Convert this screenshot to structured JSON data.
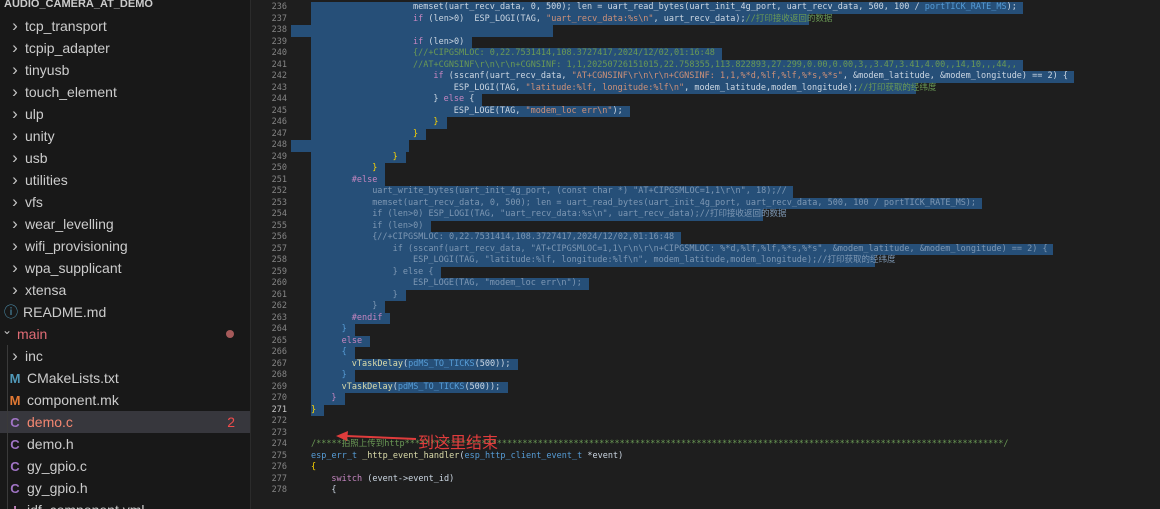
{
  "explorer": {
    "items": [
      {
        "label": "AUDIO_CAMERA_AT_DEMO",
        "kind": "header"
      },
      {
        "label": "tcp_transport",
        "kind": "folder"
      },
      {
        "label": "tcpip_adapter",
        "kind": "folder"
      },
      {
        "label": "tinyusb",
        "kind": "folder"
      },
      {
        "label": "touch_element",
        "kind": "folder"
      },
      {
        "label": "ulp",
        "kind": "folder"
      },
      {
        "label": "unity",
        "kind": "folder"
      },
      {
        "label": "usb",
        "kind": "folder"
      },
      {
        "label": "utilities",
        "kind": "folder"
      },
      {
        "label": "vfs",
        "kind": "folder"
      },
      {
        "label": "wear_levelling",
        "kind": "folder"
      },
      {
        "label": "wifi_provisioning",
        "kind": "folder"
      },
      {
        "label": "wpa_supplicant",
        "kind": "folder"
      },
      {
        "label": "xtensa",
        "kind": "folder"
      },
      {
        "label": "README.md",
        "kind": "file",
        "icon": "info-icon",
        "icon_char": "ⓘ",
        "icon_color": "#519aba"
      },
      {
        "label": "main",
        "kind": "open-folder",
        "modified": true
      },
      {
        "label": "inc",
        "kind": "subfolder"
      },
      {
        "label": "CMakeLists.txt",
        "kind": "file2",
        "icon": "cmake-icon",
        "icon_char": "M",
        "icon_color": "#519aba"
      },
      {
        "label": "component.mk",
        "kind": "file2",
        "icon": "makefile-icon",
        "icon_char": "M",
        "icon_color": "#e37933"
      },
      {
        "label": "demo.c",
        "kind": "file2",
        "icon": "c-file-icon",
        "icon_char": "C",
        "icon_color": "#a074c4",
        "active": true,
        "badge": "2"
      },
      {
        "label": "demo.h",
        "kind": "file2",
        "icon": "c-header-icon",
        "icon_char": "C",
        "icon_color": "#a074c4"
      },
      {
        "label": "gy_gpio.c",
        "kind": "file2",
        "icon": "c-file-icon",
        "icon_char": "C",
        "icon_color": "#a074c4"
      },
      {
        "label": "gy_gpio.h",
        "kind": "file2",
        "icon": "c-header-icon",
        "icon_char": "C",
        "icon_color": "#a074c4"
      },
      {
        "label": "idf_component.yml",
        "kind": "file2",
        "icon": "yaml-exclamation-icon",
        "icon_char": "!",
        "icon_color": "#c586c0"
      }
    ]
  },
  "editor": {
    "current_line": "271",
    "lines": [
      {
        "n": "236",
        "indent": 20,
        "tokens": [
          {
            "c": "t-text",
            "t": "memset(uart_recv_data, 0, 500); len = uart_read_bytes(uart_init_4g_port, uart_recv_data, 500, 100 / "
          },
          {
            "c": "t-mac",
            "t": "portTICK_RATE_MS"
          },
          {
            "c": "t-text",
            "t": ");"
          }
        ]
      },
      {
        "n": "237",
        "indent": 20,
        "tokens": [
          {
            "c": "t-kw",
            "t": "if"
          },
          {
            "c": "t-text",
            "t": " (len>0)  ESP_LOGI(TAG, "
          },
          {
            "c": "t-str",
            "t": "\"uart_recv_data:%s\\n\""
          },
          {
            "c": "t-text",
            "t": ", uart_recv_data);"
          },
          {
            "c": "t-com",
            "t": "//打印接收返回的数据"
          }
        ]
      },
      {
        "n": "238",
        "indent": 0,
        "tokens": []
      },
      {
        "n": "239",
        "indent": 20,
        "tokens": [
          {
            "c": "t-kw",
            "t": "if"
          },
          {
            "c": "t-text",
            "t": " (len>0)"
          }
        ]
      },
      {
        "n": "240",
        "indent": 20,
        "tokens": [
          {
            "c": "t-com",
            "t": "{//+CIPGSMLOC: 0,22.7531414,108.3727417,2024/12/02,01:16:48"
          }
        ]
      },
      {
        "n": "241",
        "indent": 20,
        "tokens": [
          {
            "c": "t-com",
            "t": "//AT+CGNSINF\\r\\n\\r\\n+CGNSINF: 1,1,20250726151015,22.758355,113.822893,27.299,0.00,0.00,3,,3.47,3.41,4.00,,14,10,,,44,,"
          }
        ]
      },
      {
        "n": "242",
        "indent": 24,
        "tokens": [
          {
            "c": "t-kw",
            "t": "if"
          },
          {
            "c": "t-text",
            "t": " (sscanf(uart_recv_data, "
          },
          {
            "c": "t-str",
            "t": "\"AT+CGNSINF\\r\\n\\r\\n+CGNSINF: 1,1,%*d,%lf,%lf,%*s,%*s\""
          },
          {
            "c": "t-text",
            "t": ", &modem_latitude, &modem_longitude) == 2) {"
          }
        ]
      },
      {
        "n": "243",
        "indent": 28,
        "tokens": [
          {
            "c": "t-text",
            "t": "ESP_LOGI(TAG, "
          },
          {
            "c": "t-str",
            "t": "\"latitude:%lf, longitude:%lf\\n\""
          },
          {
            "c": "t-text",
            "t": ", modem_latitude,modem_longitude);"
          },
          {
            "c": "t-com",
            "t": "//打印获取的经纬度"
          }
        ]
      },
      {
        "n": "244",
        "indent": 24,
        "tokens": [
          {
            "c": "t-text",
            "t": "} "
          },
          {
            "c": "t-kw",
            "t": "else"
          },
          {
            "c": "t-text",
            "t": " {"
          }
        ]
      },
      {
        "n": "245",
        "indent": 28,
        "tokens": [
          {
            "c": "t-text",
            "t": "ESP_LOGE(TAG, "
          },
          {
            "c": "t-str",
            "t": "\"modem_loc err\\n\""
          },
          {
            "c": "t-text",
            "t": ");"
          }
        ]
      },
      {
        "n": "246",
        "indent": 24,
        "tokens": [
          {
            "c": "t-brace",
            "t": "}"
          }
        ]
      },
      {
        "n": "247",
        "indent": 20,
        "tokens": [
          {
            "c": "t-brace",
            "t": "}"
          }
        ]
      },
      {
        "n": "248",
        "indent": 0,
        "tokens": []
      },
      {
        "n": "249",
        "indent": 16,
        "tokens": [
          {
            "c": "t-brace",
            "t": "}"
          }
        ]
      },
      {
        "n": "250",
        "indent": 12,
        "tokens": [
          {
            "c": "t-brace",
            "t": "}"
          }
        ]
      },
      {
        "n": "251",
        "indent": 8,
        "tokens": [
          {
            "c": "t-kw",
            "t": "#else"
          }
        ]
      },
      {
        "n": "252",
        "indent": 12,
        "tokens": [
          {
            "c": "t-dim",
            "t": "uart_write_bytes(uart_init_4g_port, (const char *) \"AT+CIPGSMLOC=1,1\\r\\n\", 18);//"
          }
        ]
      },
      {
        "n": "253",
        "indent": 12,
        "tokens": [
          {
            "c": "t-dim",
            "t": "memset(uart_recv_data, 0, 500); len = uart_read_bytes(uart_init_4g_port, uart_recv_data, 500, 100 / portTICK_RATE_MS);"
          }
        ]
      },
      {
        "n": "254",
        "indent": 12,
        "tokens": [
          {
            "c": "t-dim",
            "t": "if (len>0) ESP_LOGI(TAG, \"uart_recv_data:%s\\n\", uart_recv_data);//打印接收返回的数据"
          }
        ]
      },
      {
        "n": "255",
        "indent": 12,
        "tokens": [
          {
            "c": "t-dim",
            "t": "if (len>0)"
          }
        ]
      },
      {
        "n": "256",
        "indent": 12,
        "tokens": [
          {
            "c": "t-dim",
            "t": "{//+CIPGSMLOC: 0,22.7531414,108.3727417,2024/12/02,01:16:48"
          }
        ]
      },
      {
        "n": "257",
        "indent": 16,
        "tokens": [
          {
            "c": "t-dim",
            "t": "if (sscanf(uart_recv_data, \"AT+CIPGSMLOC=1,1\\r\\n\\r\\n+CIPGSMLOC: %*d,%lf,%lf,%*s,%*s\", &modem_latitude, &modem_longitude) == 2) {"
          }
        ]
      },
      {
        "n": "258",
        "indent": 20,
        "tokens": [
          {
            "c": "t-dim",
            "t": "ESP_LOGI(TAG, \"latitude:%lf, longitude:%lf\\n\", modem_latitude,modem_longitude);//打印获取的经纬度"
          }
        ]
      },
      {
        "n": "259",
        "indent": 16,
        "tokens": [
          {
            "c": "t-dim",
            "t": "} else {"
          }
        ]
      },
      {
        "n": "260",
        "indent": 20,
        "tokens": [
          {
            "c": "t-dim",
            "t": "ESP_LOGE(TAG, \"modem_loc err\\n\");"
          }
        ]
      },
      {
        "n": "261",
        "indent": 16,
        "tokens": [
          {
            "c": "t-dim",
            "t": "}"
          }
        ]
      },
      {
        "n": "262",
        "indent": 12,
        "tokens": [
          {
            "c": "t-dim",
            "t": "}"
          }
        ]
      },
      {
        "n": "263",
        "indent": 8,
        "tokens": [
          {
            "c": "t-kw",
            "t": "#endif"
          }
        ]
      },
      {
        "n": "264",
        "indent": 6,
        "tokens": [
          {
            "c": "t-mac",
            "t": "}"
          }
        ]
      },
      {
        "n": "265",
        "indent": 6,
        "tokens": [
          {
            "c": "t-kw",
            "t": "else"
          }
        ]
      },
      {
        "n": "266",
        "indent": 6,
        "tokens": [
          {
            "c": "t-mac",
            "t": "{"
          }
        ]
      },
      {
        "n": "267",
        "indent": 8,
        "tokens": [
          {
            "c": "t-fn",
            "t": "vTaskDelay"
          },
          {
            "c": "t-text",
            "t": "("
          },
          {
            "c": "t-mac",
            "t": "pdMS_TO_TICKS"
          },
          {
            "c": "t-text",
            "t": "(500));"
          }
        ]
      },
      {
        "n": "268",
        "indent": 6,
        "tokens": [
          {
            "c": "t-mac",
            "t": "}"
          }
        ]
      },
      {
        "n": "269",
        "indent": 6,
        "tokens": [
          {
            "c": "t-fn",
            "t": "vTaskDelay"
          },
          {
            "c": "t-text",
            "t": "("
          },
          {
            "c": "t-mac",
            "t": "pdMS_TO_TICKS"
          },
          {
            "c": "t-text",
            "t": "(500));"
          }
        ]
      },
      {
        "n": "270",
        "indent": 4,
        "tokens": [
          {
            "c": "t-kw",
            "t": "}"
          }
        ]
      },
      {
        "n": "271",
        "indent": 0,
        "tokens": [
          {
            "c": "t-brace",
            "t": "}"
          }
        ]
      },
      {
        "n": "272",
        "indent": 0,
        "tokens": []
      },
      {
        "n": "273",
        "indent": 0,
        "tokens": []
      },
      {
        "n": "274",
        "indent": 0,
        "tokens": [
          {
            "c": "t-com",
            "t": "/*****拍照上传到http*********************************************************************************************************************/"
          }
        ]
      },
      {
        "n": "275",
        "indent": 0,
        "tokens": [
          {
            "c": "t-mac",
            "t": "esp_err_t"
          },
          {
            "c": "t-text",
            "t": " "
          },
          {
            "c": "t-fn",
            "t": "_http_event_handler"
          },
          {
            "c": "t-text",
            "t": "("
          },
          {
            "c": "t-mac",
            "t": "esp_http_client_event_t"
          },
          {
            "c": "t-text",
            "t": " *event)"
          }
        ]
      },
      {
        "n": "276",
        "indent": 0,
        "tokens": [
          {
            "c": "t-brace",
            "t": "{"
          }
        ]
      },
      {
        "n": "277",
        "indent": 4,
        "tokens": [
          {
            "c": "t-kw",
            "t": "switch"
          },
          {
            "c": "t-text",
            "t": " (event->event_id)"
          }
        ]
      },
      {
        "n": "278",
        "indent": 4,
        "tokens": [
          {
            "c": "t-text",
            "t": "{"
          }
        ]
      }
    ]
  },
  "annotation": {
    "text": "到这里结束",
    "color": "#e03c3c"
  }
}
